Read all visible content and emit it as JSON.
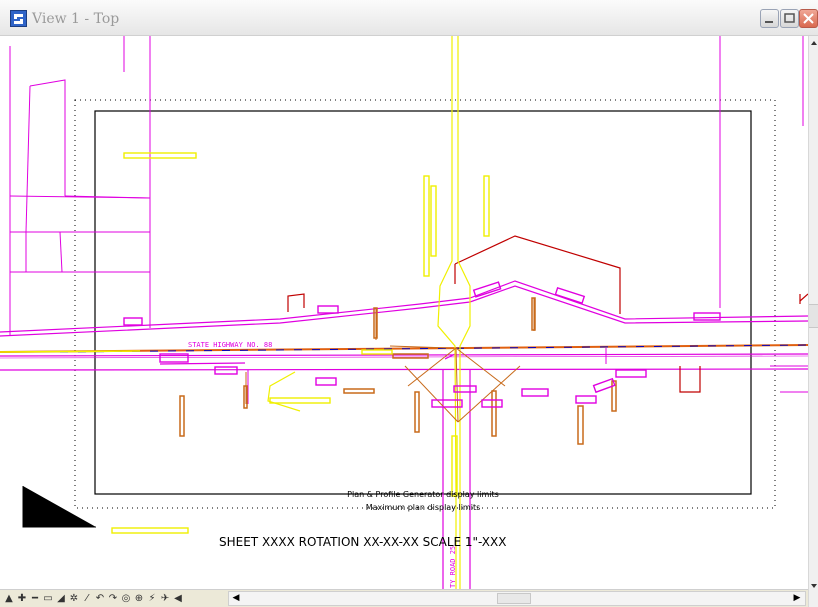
{
  "window": {
    "title": "View 1 - Top"
  },
  "labels": {
    "highway": "STATE HIGHWAY NO. 88",
    "county_road": "TY ROAD 25",
    "generator_limits": "Plan & Profile Generator display limits",
    "maximum_limits": "Maximum plan display limits",
    "sheet_info": "SHEET XXXX ROTATION XX-XX-XX SCALE 1\"-XXX"
  },
  "icons": {
    "app": "microstation-icon",
    "minimize": "minimize-icon",
    "maximize": "maximize-icon",
    "close": "close-icon"
  },
  "tools": [
    "▲",
    "✚",
    "━",
    "▭",
    "◢",
    "✲",
    "⁄",
    "↶",
    "↷",
    "◎",
    "⊕",
    "⚡",
    "✈",
    "◀"
  ],
  "colors": {
    "magenta": "#e000e0",
    "yellow": "#f0f000",
    "orange": "#c86a1a",
    "red": "#c00000",
    "blue": "#0000c0",
    "border": "#000000"
  }
}
